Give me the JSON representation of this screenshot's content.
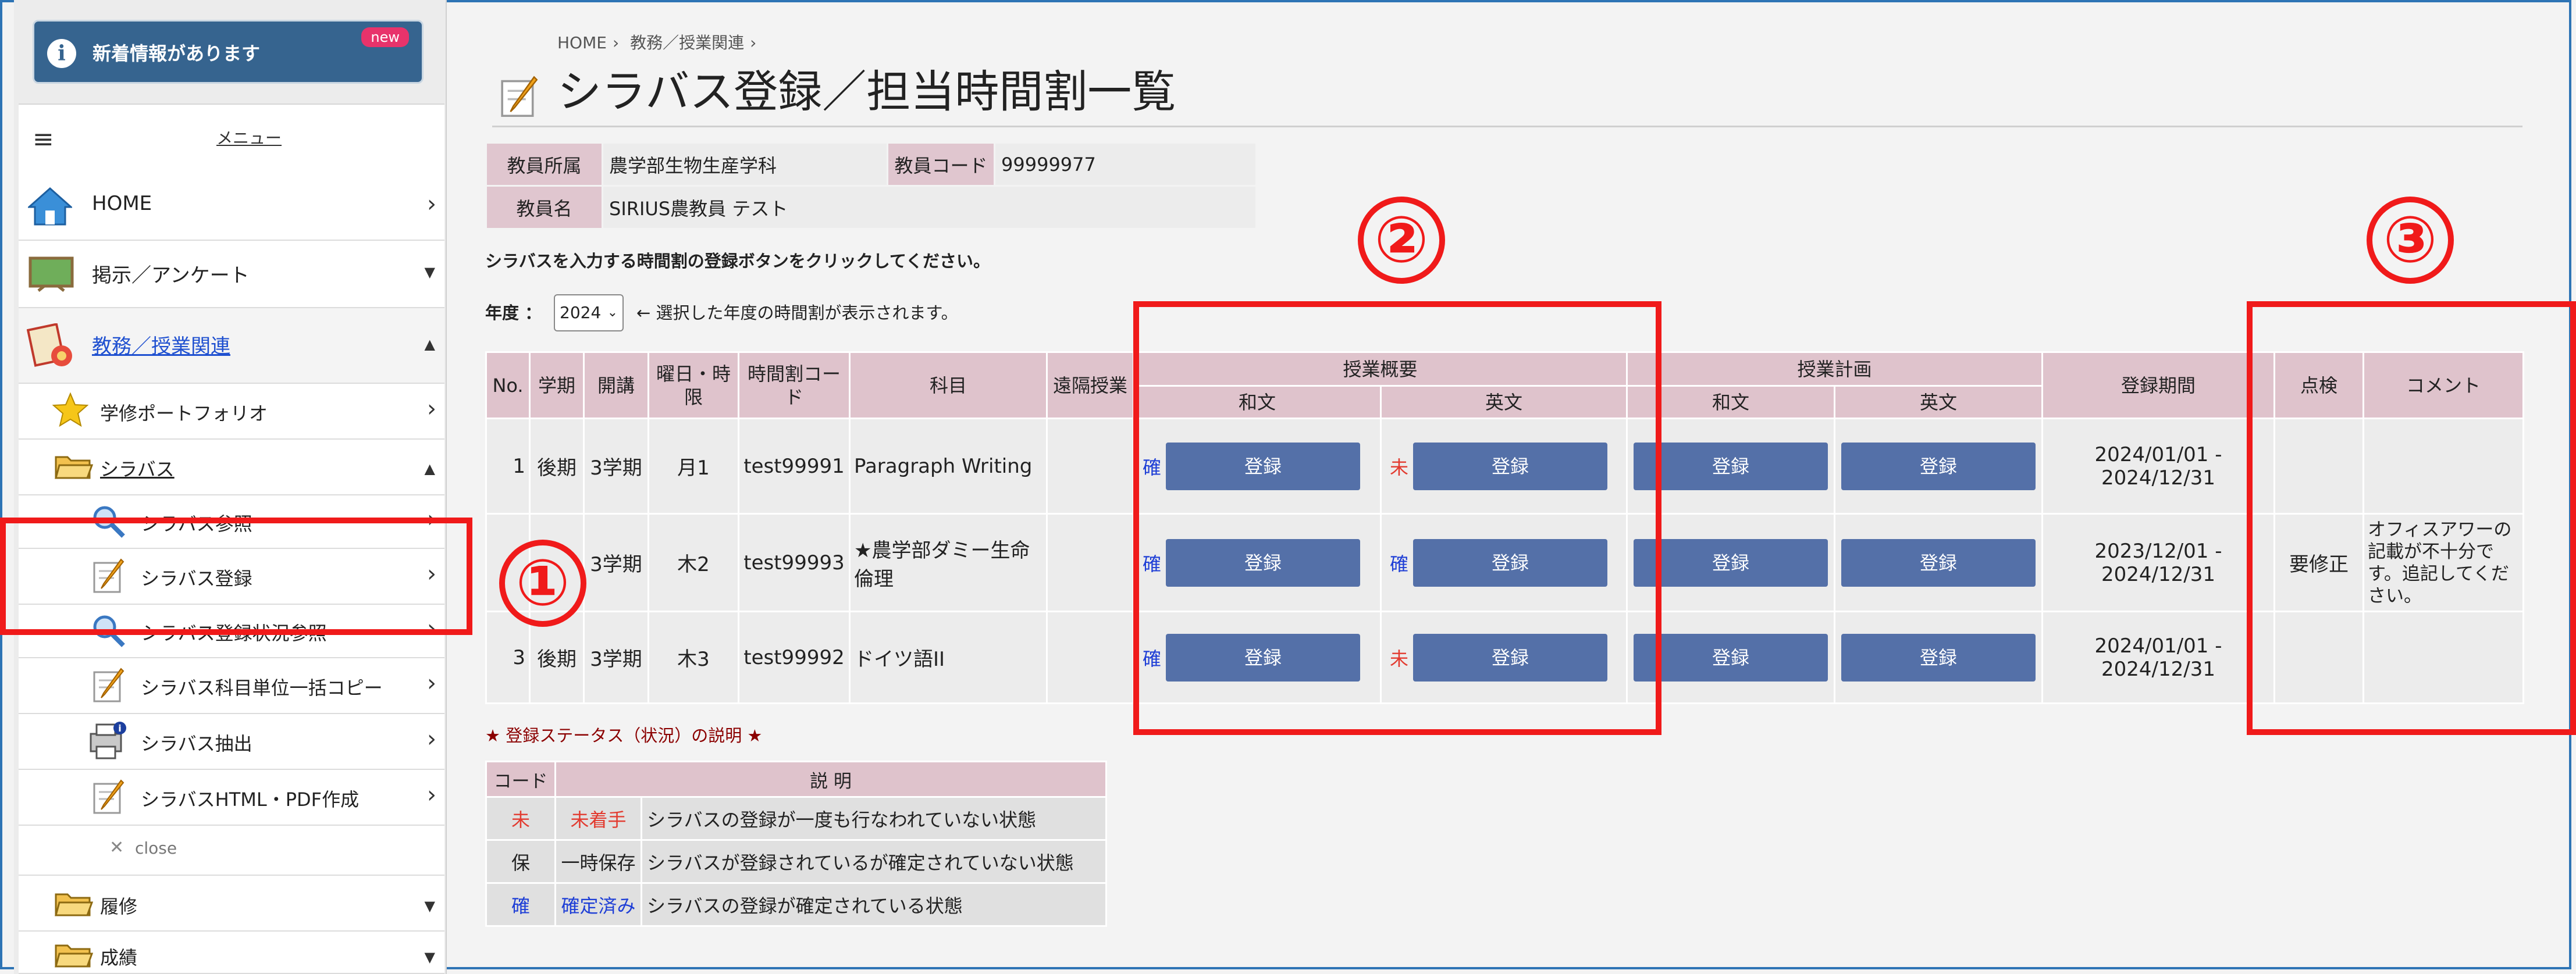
{
  "sidebar": {
    "news": {
      "text": "新着情報があります",
      "badge": "new"
    },
    "menu_label": "メニュー",
    "items": [
      {
        "label": "HOME"
      },
      {
        "label": "掲示／アンケート"
      },
      {
        "label": "教務／授業関連"
      },
      {
        "label": "学修ポートフォリオ"
      },
      {
        "label": "シラバス"
      },
      {
        "label": "シラバス参照"
      },
      {
        "label": "シラバス登録"
      },
      {
        "label": "シラバス登録状況参照"
      },
      {
        "label": "シラバス科目単位一括コピー"
      },
      {
        "label": "シラバス抽出"
      },
      {
        "label": "シラバスHTML・PDF作成"
      },
      {
        "label": "close"
      },
      {
        "label": "履修"
      },
      {
        "label": "成績"
      }
    ]
  },
  "breadcrumb": [
    "HOME",
    "教務／授業関連"
  ],
  "page_title": "シラバス登録／担当時間割一覧",
  "teacher": {
    "affiliation_label": "教員所属",
    "affiliation": "農学部生物生産学科",
    "code_label": "教員コード",
    "code": "99999977",
    "name_label": "教員名",
    "name": "SIRIUS農教員 テスト"
  },
  "instruction": "シラバスを入力する時間割の登録ボタンをクリックしてください。",
  "year": {
    "label": "年度 ：",
    "value": "2024",
    "note": "← 選択した年度の時間割が表示されます。"
  },
  "table": {
    "headers": {
      "no": "No.",
      "term": "学期",
      "open": "開講",
      "day": "曜日・時限",
      "code": "時間割コード",
      "subject": "科目",
      "remote": "遠隔授業",
      "overview": "授業概要",
      "plan": "授業計画",
      "ja": "和文",
      "en": "英文",
      "period": "登録期間",
      "check": "点検",
      "comment": "コメント"
    },
    "rows": [
      {
        "no": "1",
        "term": "後期",
        "open": "3学期",
        "day": "月1",
        "code": "test99991",
        "subject": "Paragraph Writing",
        "ov_ja_status": "確",
        "ov_en_status": "未",
        "button": "登録",
        "period": "2024/01/01 - 2024/12/31",
        "check": "",
        "comment": ""
      },
      {
        "no": "",
        "term": "",
        "open": "3学期",
        "day": "木2",
        "code": "test99993",
        "subject": "★農学部ダミー生命倫理",
        "ov_ja_status": "確",
        "ov_en_status": "確",
        "button": "登録",
        "period": "2023/12/01 - 2024/12/31",
        "check": "要修正",
        "comment": "オフィスアワーの記載が不十分です。追記してください。"
      },
      {
        "no": "3",
        "term": "後期",
        "open": "3学期",
        "day": "木3",
        "code": "test99992",
        "subject": "ドイツ語II",
        "ov_ja_status": "確",
        "ov_en_status": "未",
        "button": "登録",
        "period": "2024/01/01 - 2024/12/31",
        "check": "",
        "comment": ""
      }
    ]
  },
  "legend": {
    "title": "★ 登録ステータス（状況）の説明 ★",
    "code_header": "コード",
    "desc_header": "説 明",
    "rows": [
      {
        "code": "未",
        "name": "未着手",
        "desc": "シラバスの登録が一度も行なわれていない状態"
      },
      {
        "code": "保",
        "name": "一時保存",
        "desc": "シラバスが登録されているが確定されていない状態"
      },
      {
        "code": "確",
        "name": "確定済み",
        "desc": "シラバスの登録が確定されている状態"
      }
    ]
  },
  "annotations": [
    "①",
    "②",
    "③"
  ],
  "colors": {
    "accent": "#5470a8",
    "header_pink": "#dfc3cc",
    "annotation_red": "#f01a1a"
  }
}
